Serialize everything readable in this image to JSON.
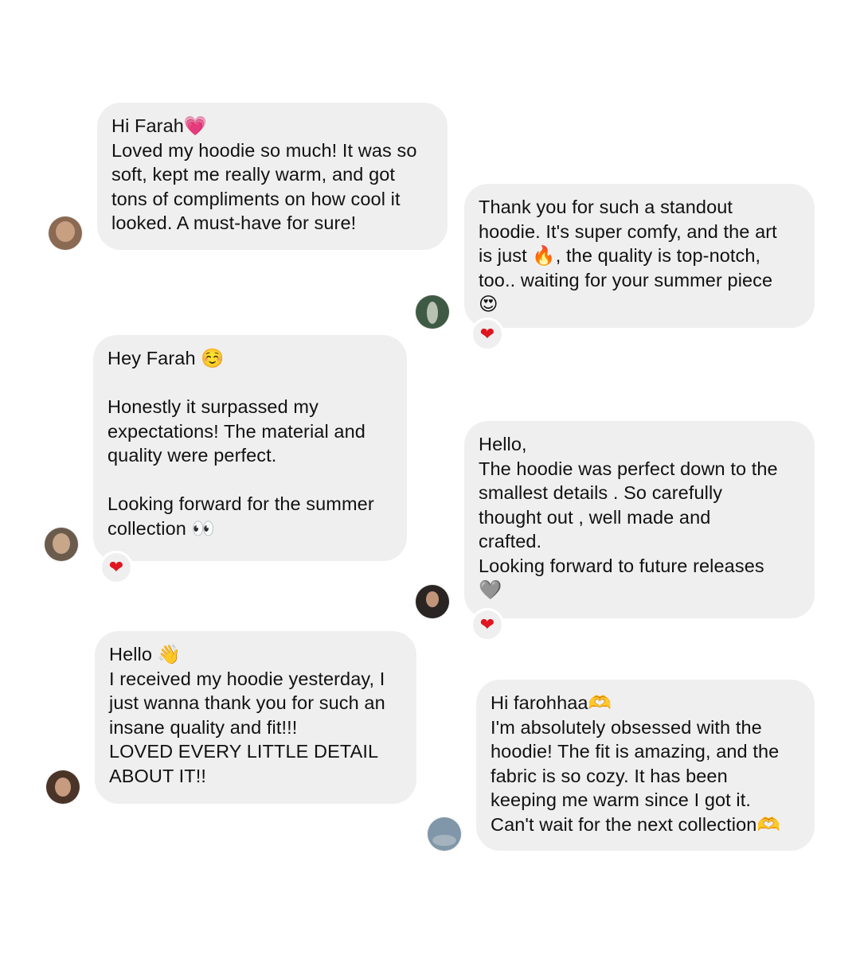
{
  "messages": [
    {
      "lines": [
        "Hi Farah💗",
        "Loved my hoodie so much! It was so",
        "soft, kept me really warm, and got",
        "tons of compliments on how cool it",
        "looked. A must-have for sure!"
      ],
      "reaction": null
    },
    {
      "lines": [
        "Thank you for such a standout",
        "hoodie. It's super comfy, and the art",
        "is just 🔥, the quality is top-notch,",
        "too.. waiting for your summer piece",
        "😍"
      ],
      "reaction": "❤"
    },
    {
      "lines": [
        "Hey Farah ☺️",
        "",
        "Honestly it surpassed my",
        "expectations! The material and",
        "quality were perfect.",
        "",
        "Looking forward for the summer",
        "collection 👀"
      ],
      "reaction": "❤"
    },
    {
      "lines": [
        "Hello,",
        "The hoodie was perfect down to the",
        "smallest details . So carefully",
        "thought out , well made and",
        "crafted.",
        "Looking forward to future releases",
        "🩶"
      ],
      "reaction": "❤"
    },
    {
      "lines": [
        "Hello 👋",
        "I received my hoodie yesterday, I",
        "just wanna thank you for such an",
        "insane quality and fit!!!",
        "LOVED EVERY LITTLE DETAIL",
        "ABOUT IT!!"
      ],
      "reaction": null
    },
    {
      "lines": [
        "Hi farohhaa🫶",
        "I'm absolutely obsessed with the",
        "hoodie! The fit is amazing, and the",
        "fabric is so cozy. It has been",
        "keeping me warm since I got it.",
        "Can't wait for the next collection🫶"
      ],
      "reaction": null
    }
  ],
  "colors": {
    "bubble": "#efefef",
    "background": "#ffffff",
    "text": "#111111",
    "reaction_heart": "#e0151f"
  }
}
